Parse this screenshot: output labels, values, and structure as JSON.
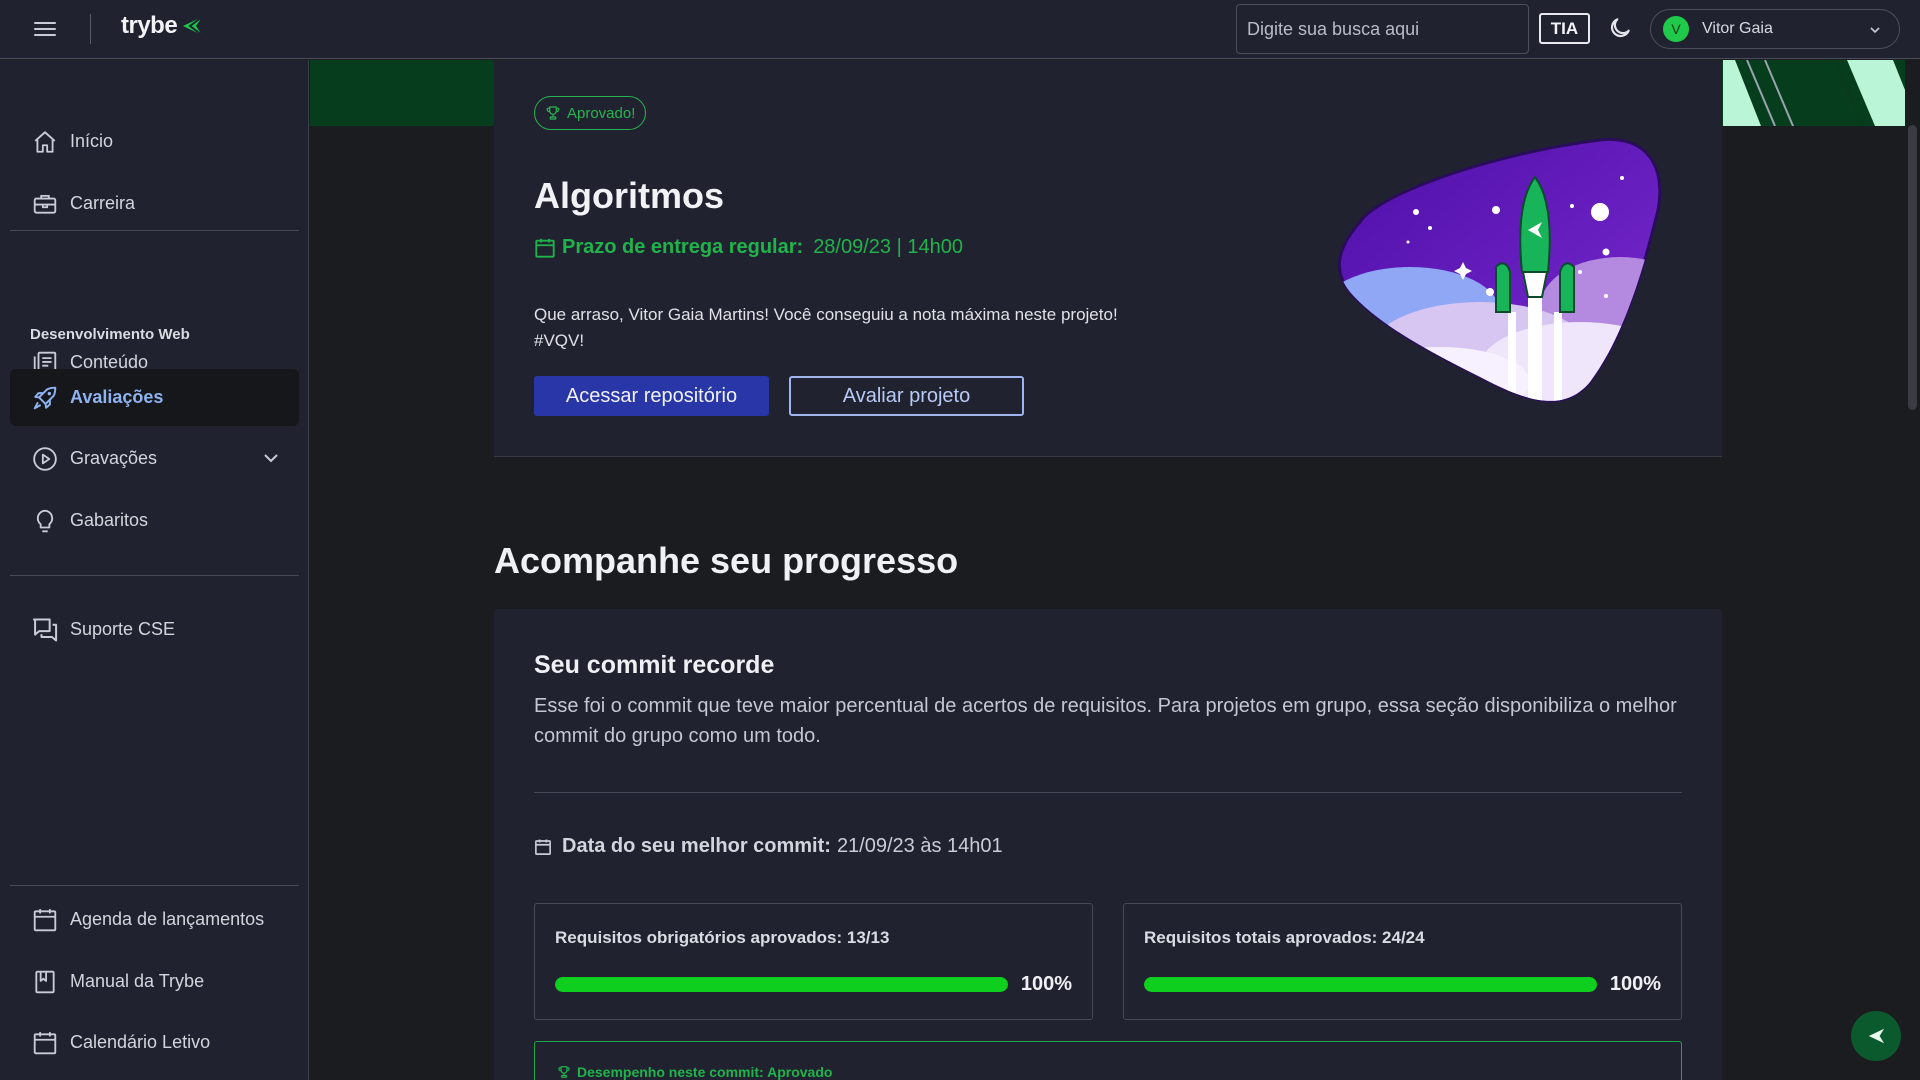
{
  "header": {
    "brand": "trybe",
    "search_placeholder": "Digite sua busca aqui",
    "tia_label": "TIA",
    "user": {
      "initial": "V",
      "name": "Vitor Gaia"
    }
  },
  "sidebar": {
    "items_top": [
      {
        "label": "Início",
        "icon": "home-icon"
      },
      {
        "label": "Carreira",
        "icon": "briefcase-icon"
      }
    ],
    "section_heading": "Desenvolvimento Web",
    "items_section": [
      {
        "label": "Conteúdo",
        "icon": "content-icon"
      },
      {
        "label": "Avaliações",
        "icon": "rocket-icon",
        "active": true
      },
      {
        "label": "Gravações",
        "icon": "play-circle-icon"
      },
      {
        "label": "Gabaritos",
        "icon": "lightbulb-icon"
      }
    ],
    "support": {
      "label": "Suporte CSE",
      "icon": "chat-icon"
    },
    "items_bottom": [
      {
        "label": "Agenda de lançamentos",
        "icon": "calendar-icon"
      },
      {
        "label": "Manual da Trybe",
        "icon": "book-icon"
      },
      {
        "label": "Calendário Letivo",
        "icon": "calendar-icon"
      }
    ]
  },
  "project": {
    "badge": "Aprovado!",
    "title": "Algoritmos",
    "deadline_label": "Prazo de entrega regular:",
    "deadline_value": "28/09/23 | 14h00",
    "message_line1": "Que arraso, Vitor Gaia Martins! Você conseguiu a nota máxima neste projeto!",
    "message_line2": "#VQV!",
    "primary_button": "Acessar repositório",
    "secondary_button": "Avaliar projeto"
  },
  "progress": {
    "section_title": "Acompanhe seu progresso",
    "card_title": "Seu commit recorde",
    "card_description": "Esse foi o commit que teve maior percentual de acertos de requisitos. Para projetos em grupo, essa seção disponibiliza o melhor commit do grupo como um todo.",
    "best_commit_label": "Data do seu melhor commit:",
    "best_commit_value": "21/09/23 às 14h01",
    "required": {
      "label": "Requisitos obrigatórios aprovados: 13/13",
      "percent_text": "100%",
      "fraction": 1.0
    },
    "total": {
      "label": "Requisitos totais aprovados: 24/24",
      "percent_text": "100%",
      "fraction": 1.0
    },
    "performance_label": "Desempenho neste commit: Aprovado"
  },
  "colors": {
    "accent_green": "#21b34b",
    "progress_green": "#0fcf1e",
    "primary_blue": "#2836a8",
    "active_nav_text": "#8fb2f0"
  }
}
